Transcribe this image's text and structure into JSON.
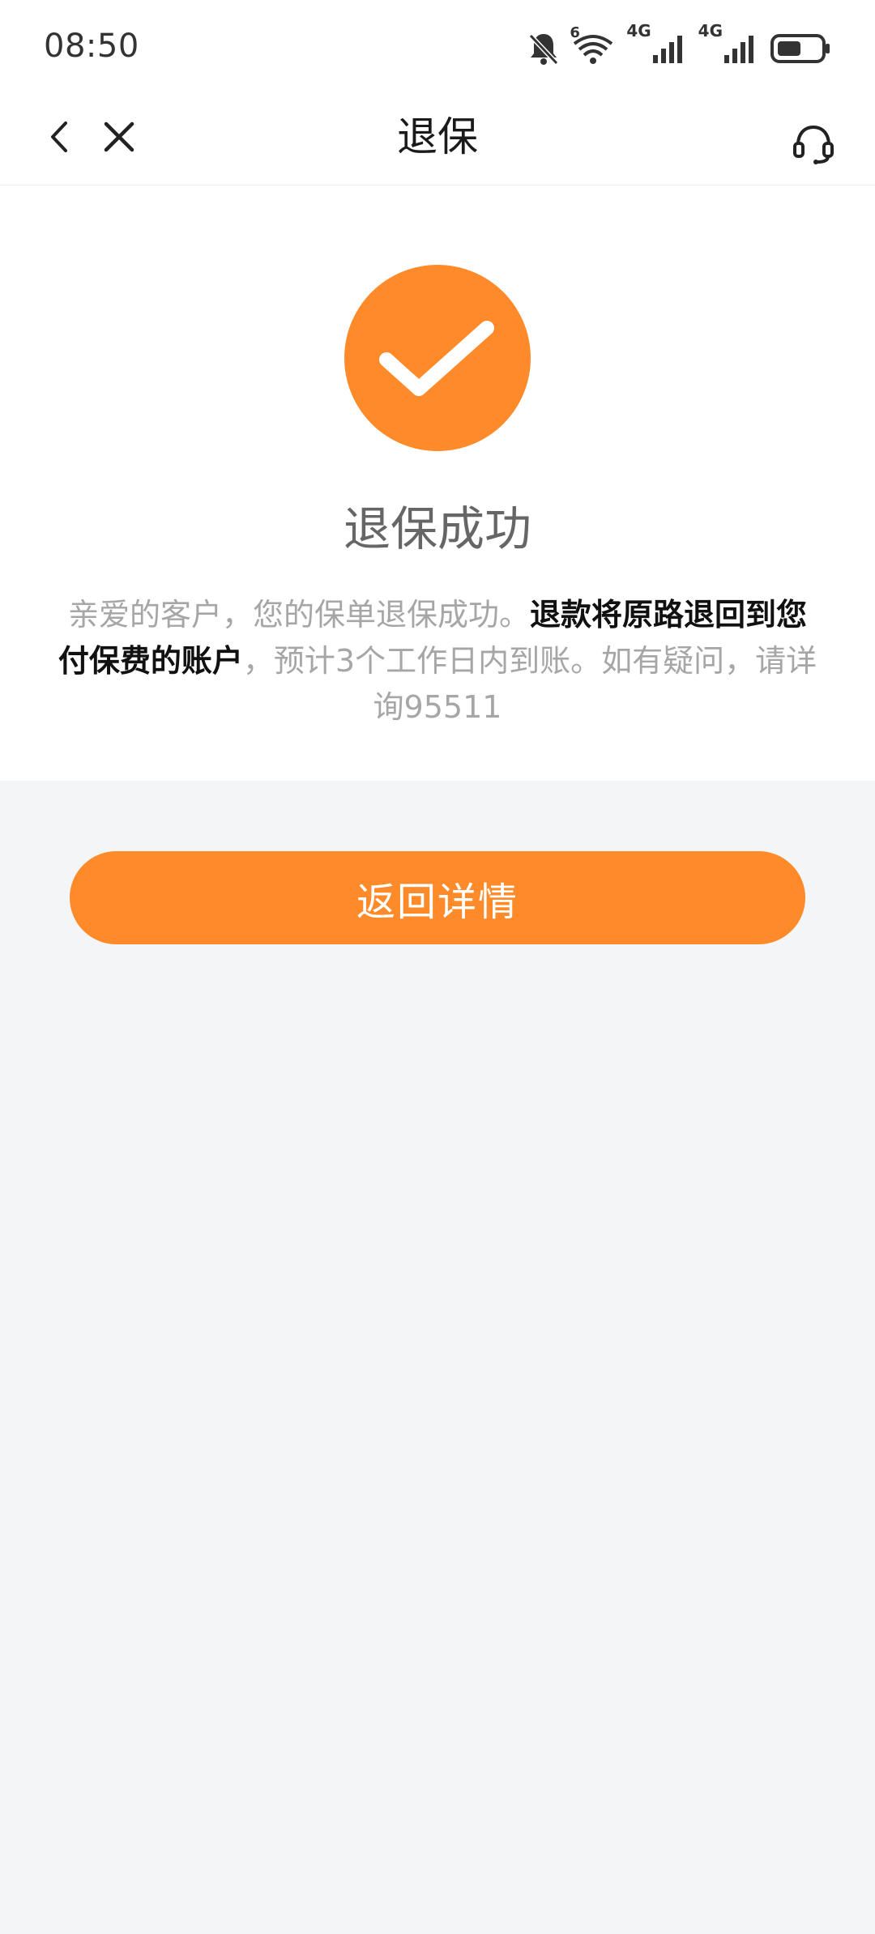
{
  "status_bar": {
    "time": "08:50",
    "icons": [
      "mute-bell-icon",
      "wifi-icon",
      "signal-4g-icon",
      "signal-4g-icon",
      "battery-icon"
    ],
    "wifi_label": "6",
    "network_label_1": "4G",
    "network_label_2": "4G"
  },
  "nav": {
    "title": "退保",
    "back_icon": "chevron-left-icon",
    "close_icon": "close-icon",
    "service_icon": "headset-icon"
  },
  "result": {
    "icon": "check-icon",
    "title": "退保成功",
    "desc_part1": "亲爱的客户，您的保单退保成功。",
    "desc_bold": "退款将原路退回到您付保费的账户",
    "desc_part2": "，预计3个工作日内到账。如有疑问，请详询95511"
  },
  "actions": {
    "return_label": "返回详情"
  },
  "colors": {
    "accent": "#ff8a2a",
    "background": "#f4f5f7",
    "card": "#ffffff",
    "muted_text": "#a6a6a6",
    "title_text": "#666666"
  }
}
